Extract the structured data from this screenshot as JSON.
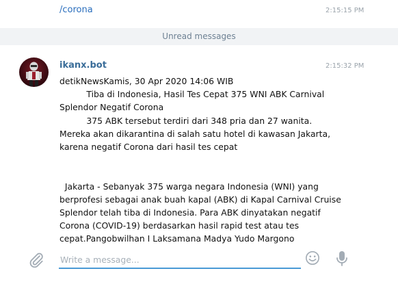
{
  "outgoing": {
    "text": "/corona",
    "time": "2:15:15 PM"
  },
  "unread_divider": "Unread messages",
  "message": {
    "sender": "ikanx.bot",
    "time": "2:15:32 PM",
    "lines": [
      "detikNewsKamis, 30 Apr 2020 14:06 WIB",
      "          Tiba di Indonesia, Hasil Tes Cepat 375 WNI ABK Carnival",
      "Splendor Negatif Corona",
      "          375 ABK tersebut terdiri dari 348 pria dan 27 wanita.",
      "Mereka akan dikarantina di salah satu hotel di kawasan Jakarta,",
      "karena negatif Corona dari hasil tes cepat",
      "",
      "",
      "  Jakarta - Sebanyak 375 warga negara Indonesia (WNI) yang",
      "berprofesi sebagai anak buah kapal (ABK) di Kapal Carnival Cruise",
      "Splendor telah tiba di Indonesia. Para ABK dinyatakan negatif",
      "Corona (COVID-19) berdasarkan hasil rapid test atau tes",
      "cepat.Pangobwilhan I Laksamana Madya Yudo Margono"
    ]
  },
  "composer": {
    "placeholder": "Write a message...",
    "attach_icon": "paperclip-icon",
    "emoji_icon": "smiley-icon",
    "mic_icon": "microphone-icon"
  },
  "colors": {
    "accent": "#4a9ad6",
    "link": "#2a6ebd",
    "sender": "#3a6d99",
    "divider_bg": "#f1f3f5"
  }
}
